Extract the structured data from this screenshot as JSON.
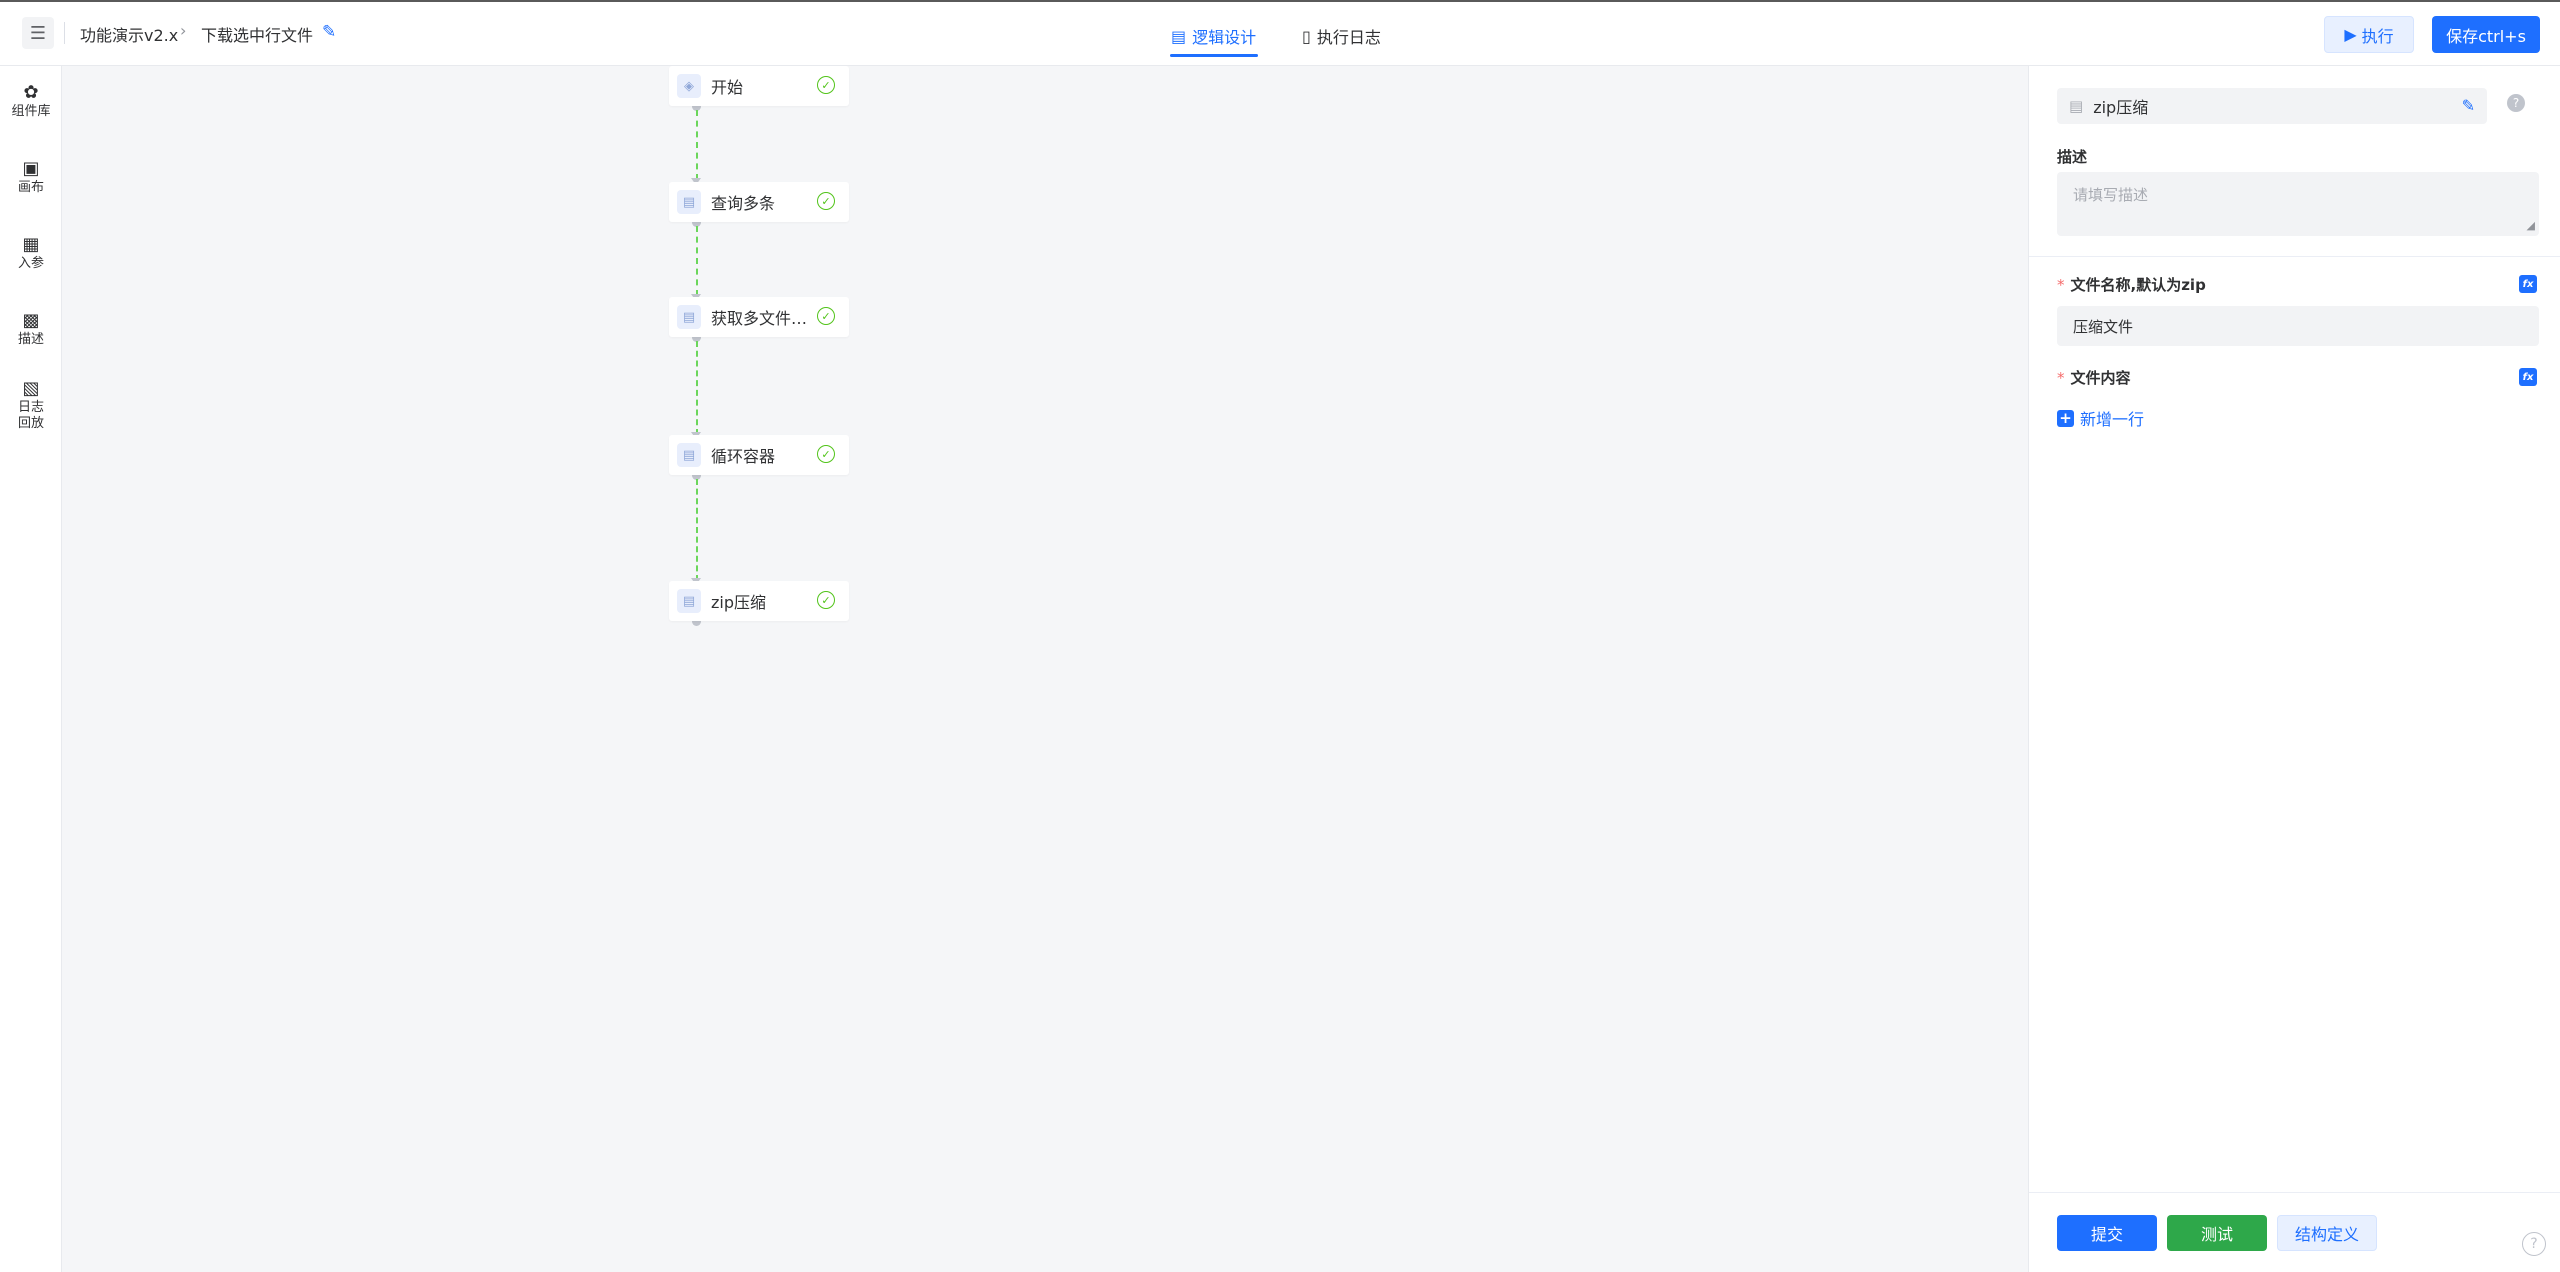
{
  "header": {
    "breadcrumb": [
      "功能演示v2.x",
      "下载选中行文件"
    ],
    "tabs": [
      {
        "label": "逻辑设计",
        "active": true
      },
      {
        "label": "执行日志",
        "active": false
      }
    ],
    "execute_label": "执行",
    "save_label": "保存ctrl+s"
  },
  "sidebar": {
    "items": [
      {
        "label": "组件库",
        "icon": "puzzle-icon"
      },
      {
        "label": "画布",
        "icon": "canvas-icon"
      },
      {
        "label": "入参",
        "icon": "input-params-icon"
      },
      {
        "label": "描述",
        "icon": "description-icon"
      },
      {
        "label": "日志\n回放",
        "icon": "log-replay-icon"
      }
    ]
  },
  "flow": {
    "nodes": [
      {
        "label": "开始",
        "icon": "layers-icon",
        "status": "success"
      },
      {
        "label": "查询多条",
        "icon": "node-doc-icon",
        "status": "success"
      },
      {
        "label": "获取多文件地址",
        "icon": "node-doc-icon",
        "status": "success"
      },
      {
        "label": "循环容器",
        "icon": "node-doc-icon",
        "status": "success"
      },
      {
        "label": "zip压缩",
        "icon": "node-doc-icon",
        "status": "success"
      }
    ]
  },
  "panel": {
    "node_name": "zip压缩",
    "description_label": "描述",
    "description_placeholder": "请填写描述",
    "fields": [
      {
        "label": "文件名称,默认为zip",
        "required": true,
        "value": "压缩文件"
      },
      {
        "label": "文件内容",
        "required": true
      }
    ],
    "add_row_label": "新增一行",
    "buttons": {
      "submit": "提交",
      "test": "测试",
      "structure": "结构定义"
    }
  },
  "colors": {
    "primary": "#1e6fff",
    "success": "#52c41a",
    "test_button": "#2ea84a",
    "required": "#f56c6c"
  }
}
